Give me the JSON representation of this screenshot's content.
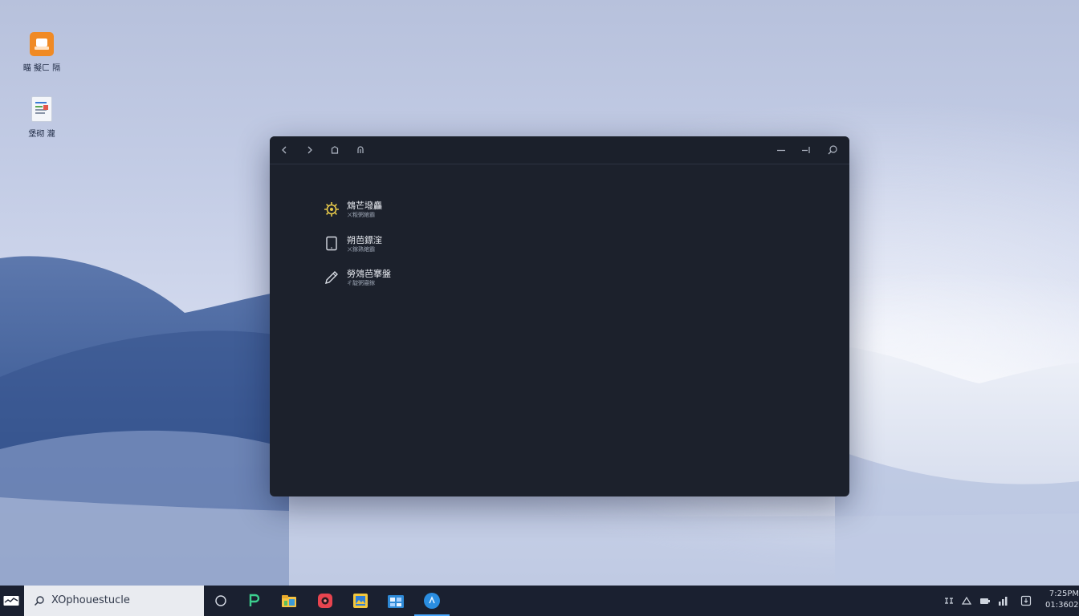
{
  "desktop": {
    "icons": [
      {
        "label": "瞄 擬ㄈ 隔",
        "icon": "orange-app-icon"
      },
      {
        "label": "堡砌 瀧",
        "icon": "document-icon"
      }
    ]
  },
  "window": {
    "titlebar": {
      "buttons": [
        "back-icon",
        "forward-icon",
        "home-icon",
        "pin-icon",
        "minimize-icon",
        "restore-icon",
        "search-icon"
      ]
    },
    "menu": [
      {
        "title": "鴆芒墢麤",
        "subtitle": "ㄨ粄粥綰霸",
        "icon": "settings-gear-icon",
        "color": "#e5c84a"
      },
      {
        "title": "朔芭鏢漥",
        "subtitle": "ㄨ鎵熟綰霸",
        "icon": "tablet-icon",
        "color": "#d8dce4"
      },
      {
        "title": "勞鵁芭搴盤",
        "subtitle": "ㄔ靛粥寢鎵",
        "icon": "pencil-icon",
        "color": "#d8dce4"
      }
    ]
  },
  "taskbar": {
    "search": {
      "text": "XOphouestucle"
    },
    "apps": [
      "circle-icon",
      "p-app-icon",
      "file-explorer-icon",
      "red-app-icon",
      "photos-icon",
      "store-icon",
      "blue-app-icon"
    ],
    "tray": [
      "network-icon",
      "chevron-up-icon",
      "wifi-icon",
      "battery-icon",
      "notification-icon"
    ],
    "clock": {
      "time": "7:25PM",
      "date": "01:36025"
    }
  },
  "colors": {
    "window_bg": "#1c212c",
    "taskbar_bg": "#1a2030",
    "accent": "#4aa8ff"
  }
}
